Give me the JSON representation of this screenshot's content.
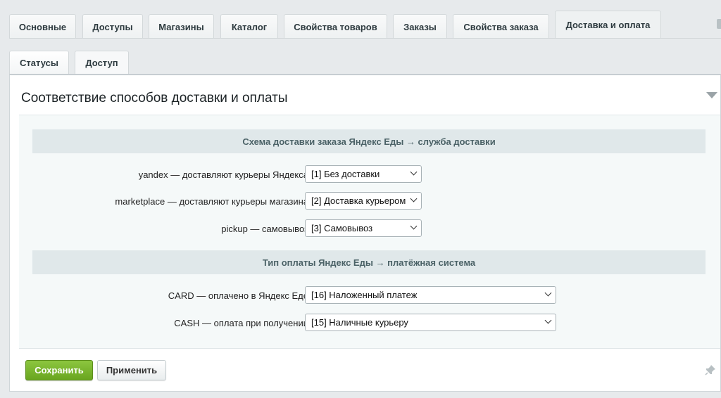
{
  "tabs": [
    {
      "label": "Основные",
      "active": false
    },
    {
      "label": "Доступы",
      "active": false
    },
    {
      "label": "Магазины",
      "active": false
    },
    {
      "label": "Каталог",
      "active": false
    },
    {
      "label": "Свойства товаров",
      "active": false
    },
    {
      "label": "Заказы",
      "active": false
    },
    {
      "label": "Свойства заказа",
      "active": false
    },
    {
      "label": "Доставка и оплата",
      "active": true
    }
  ],
  "subtabs": [
    {
      "label": "Статусы",
      "active": false
    },
    {
      "label": "Доступ",
      "active": true
    }
  ],
  "panel": {
    "title": "Соответствие способов доставки и оплаты"
  },
  "delivery": {
    "heading": "Схема доставки заказа Яндекс Еды → служба доставки",
    "rows": [
      {
        "label": "yandex — доставляют курьеры Яндекса",
        "value": "[1] Без доставки"
      },
      {
        "label": "marketplace — доставляют курьеры магазина",
        "value": "[2] Доставка курьером"
      },
      {
        "label": "pickup — самовывоз",
        "value": "[3] Самовывоз"
      }
    ]
  },
  "payment": {
    "heading": "Тип оплаты Яндекс Еды → платёжная система",
    "rows": [
      {
        "label": "CARD — оплачено в Яндекс Еде",
        "value": "[16] Наложенный платеж"
      },
      {
        "label": "CASH — оплата при получении",
        "value": "[15] Наличные курьеру"
      }
    ]
  },
  "footer": {
    "save_label": "Сохранить",
    "apply_label": "Применить"
  },
  "colors": {
    "accent_green": "#76b82a",
    "section_bg": "#e0e8ea"
  }
}
